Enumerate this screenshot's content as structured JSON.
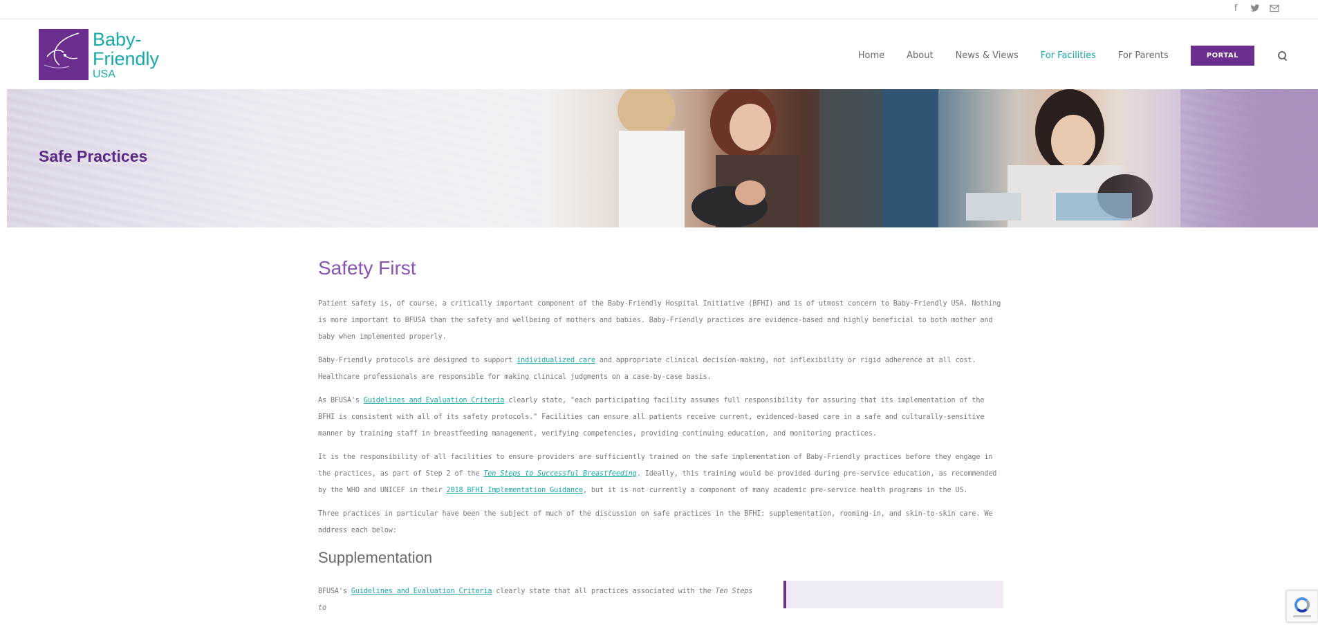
{
  "social": {
    "icons": [
      "facebook-icon",
      "twitter-icon",
      "email-icon"
    ],
    "glyphs": [
      "f",
      "🐦",
      "✉"
    ]
  },
  "logo": {
    "line1": "Baby-",
    "line2": "Friendly",
    "line3": "USA"
  },
  "nav": {
    "items": [
      {
        "label": "Home",
        "active": false
      },
      {
        "label": "About",
        "active": false
      },
      {
        "label": "News & Views",
        "active": false
      },
      {
        "label": "For Facilities",
        "active": true
      },
      {
        "label": "For Parents",
        "active": false
      }
    ],
    "portal_label": "PORTAL"
  },
  "hero": {
    "title": "Safe Practices"
  },
  "main": {
    "title": "Safety First",
    "p1": "Patient safety is, of course, a critically important component of the Baby-Friendly Hospital Initiative (BFHI) and is of utmost concern to Baby-Friendly USA. Nothing is more important to BFUSA than the safety and wellbeing of mothers and babies. Baby-Friendly practices are evidence-based and highly beneficial to both mother and baby when implemented properly.",
    "p2": {
      "a": "Baby-Friendly protocols are designed to support ",
      "link": "individualized care",
      "b": " and appropriate clinical decision-making, not inflexibility or rigid adherence at all cost. Healthcare professionals are responsible for making clinical judgments on a case-by-case basis."
    },
    "p3": {
      "a": "As BFUSA's ",
      "link": "Guidelines and Evaluation Criteria",
      "b": " clearly state, \"each participating facility assumes full responsibility for assuring that its implementation of the BFHI is consistent with all of its safety protocols.\" Facilities can ensure all patients receive current, evidenced-based care in a safe and culturally-sensitive manner by training staff in breastfeeding management, verifying competencies, providing continuing education, and monitoring practices."
    },
    "p4": {
      "a": "It is the responsibility of all facilities to ensure providers are sufficiently trained on the safe implementation of Baby-Friendly practices before they engage in the practices, as part of Step 2 of the ",
      "link1": "Ten Steps to Successful Breastfeeding",
      "b": ". Ideally, this training would be provided during pre-service education, as recommended by the WHO and UNICEF in their ",
      "link2": "2018 BFHI Implementation Guidance",
      "c": ", but it is not currently a component of many academic pre-service health programs in the US."
    },
    "p5": "Three practices in particular have been the subject of much of the discussion on safe practices in the BFHI: supplementation, rooming-in, and skin-to-skin care. We address each below:",
    "sub_title": "Supplementation",
    "p6": {
      "a": "BFUSA's ",
      "link": "Guidelines and Evaluation Criteria",
      "b": " clearly state that all practices associated with the ",
      "em": "Ten Steps to"
    }
  },
  "colors": {
    "brand_purple": "#6b2e8f",
    "accent_teal": "#17a9a9",
    "heading_purple": "#8a54b4"
  }
}
